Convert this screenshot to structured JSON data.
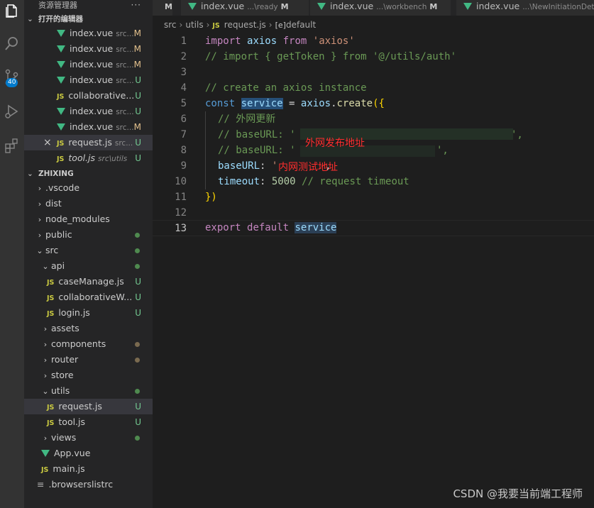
{
  "sidebar": {
    "title": "资源管理器",
    "more": "···",
    "open_editors_label": "打开的编辑器",
    "open_editors": [
      {
        "icon": "vue",
        "name": "index.vue",
        "hint": "src...",
        "status": "M",
        "status_color": "#e2c08d"
      },
      {
        "icon": "vue",
        "name": "index.vue",
        "hint": "src...",
        "status": "M",
        "status_color": "#e2c08d"
      },
      {
        "icon": "vue",
        "name": "index.vue",
        "hint": "src...",
        "status": "M",
        "status_color": "#e2c08d"
      },
      {
        "icon": "vue",
        "name": "index.vue",
        "hint": "src...",
        "status": "U",
        "status_color": "#73c991"
      },
      {
        "icon": "js",
        "name": "collaborative...",
        "hint": "",
        "status": "U",
        "status_color": "#73c991"
      },
      {
        "icon": "vue",
        "name": "index.vue",
        "hint": "src...",
        "status": "U",
        "status_color": "#73c991"
      },
      {
        "icon": "vue",
        "name": "index.vue",
        "hint": "src...",
        "status": "M",
        "status_color": "#e2c08d"
      },
      {
        "icon": "js",
        "name": "request.js",
        "hint": "src...",
        "status": "U",
        "status_color": "#73c991",
        "close": "×"
      },
      {
        "icon": "js",
        "name": "tool.js",
        "hint": "src\\utils",
        "status": "U",
        "status_color": "#73c991"
      }
    ],
    "project_label": "ZHIXING",
    "tree": [
      {
        "depth": 0,
        "type": "folder",
        "open": false,
        "name": ".vscode"
      },
      {
        "depth": 0,
        "type": "folder",
        "open": false,
        "name": "dist"
      },
      {
        "depth": 0,
        "type": "folder",
        "open": false,
        "name": "node_modules"
      },
      {
        "depth": 0,
        "type": "folder",
        "open": false,
        "name": "public",
        "dot": "#4f8a4f"
      },
      {
        "depth": 0,
        "type": "folder",
        "open": true,
        "name": "src",
        "dot": "#4f8a4f"
      },
      {
        "depth": 1,
        "type": "folder",
        "open": true,
        "name": "api",
        "dot": "#4f8a4f"
      },
      {
        "depth": 2,
        "type": "js",
        "name": "caseManage.js",
        "status": "U"
      },
      {
        "depth": 2,
        "type": "js",
        "name": "collaborativeW...",
        "status": "U"
      },
      {
        "depth": 2,
        "type": "js",
        "name": "login.js",
        "status": "U"
      },
      {
        "depth": 1,
        "type": "folder",
        "open": false,
        "name": "assets"
      },
      {
        "depth": 1,
        "type": "folder",
        "open": false,
        "name": "components",
        "dot": "#7a6a4f"
      },
      {
        "depth": 1,
        "type": "folder",
        "open": false,
        "name": "router",
        "dot": "#7a6a4f"
      },
      {
        "depth": 1,
        "type": "folder",
        "open": false,
        "name": "store"
      },
      {
        "depth": 1,
        "type": "folder",
        "open": true,
        "name": "utils",
        "dot": "#4f8a4f"
      },
      {
        "depth": 2,
        "type": "js",
        "name": "request.js",
        "status": "U",
        "selected": true
      },
      {
        "depth": 2,
        "type": "js",
        "name": "tool.js",
        "status": "U"
      },
      {
        "depth": 1,
        "type": "folder",
        "open": false,
        "name": "views",
        "dot": "#4f8a4f"
      },
      {
        "depth": 1,
        "type": "vue",
        "name": "App.vue"
      },
      {
        "depth": 1,
        "type": "js",
        "name": "main.js"
      },
      {
        "depth": 0,
        "type": "file",
        "name": ".browserslistrc"
      }
    ]
  },
  "tabs": [
    {
      "name": "M",
      "desc": "",
      "mod": ""
    },
    {
      "name": "index.vue",
      "desc": "...\\ready",
      "mod": "M"
    },
    {
      "name": "index.vue",
      "desc": "...\\workbench",
      "mod": "M"
    },
    {
      "name": "index.vue",
      "desc": "...\\NewInitiationDetail",
      "mod": ""
    }
  ],
  "breadcrumb": {
    "p1": "src",
    "p2": "utils",
    "p3": "request.js",
    "p4": "default"
  },
  "editor": {
    "line_numbers": [
      "1",
      "2",
      "3",
      "4",
      "5",
      "6",
      "7",
      "8",
      "9",
      "10",
      "11",
      "12",
      "13"
    ],
    "l1": {
      "kw": "import",
      "var": "axios",
      "from": "from",
      "str": "'axios'"
    },
    "l2": "// import { getToken } from '@/utils/auth'",
    "l4": "// create an axios instance",
    "l5": {
      "kw": "const",
      "var": "service",
      "eq": " = ",
      "obj": "axios",
      "dot": ".",
      "fn": "create",
      "open": "({"
    },
    "l6": "// 外网更新",
    "l7": {
      "cm": "// baseURL: '",
      "tail": "',"
    },
    "l8": {
      "cm": "// baseURL: '",
      "tail": "',"
    },
    "l9": {
      "key": "baseURL",
      "colon": ": ",
      "str": "'",
      "tail": ","
    },
    "l10": {
      "key": "timeout",
      "colon": ": ",
      "num": "5000",
      "cm": " // request timeout"
    },
    "l11": "})",
    "l13": {
      "kw1": "export",
      "kw2": "default",
      "var": "service"
    }
  },
  "annotations": {
    "external": "外网发布地址",
    "internal": "内网测试地址"
  },
  "watermark": "CSDN @我要当前端工程师"
}
